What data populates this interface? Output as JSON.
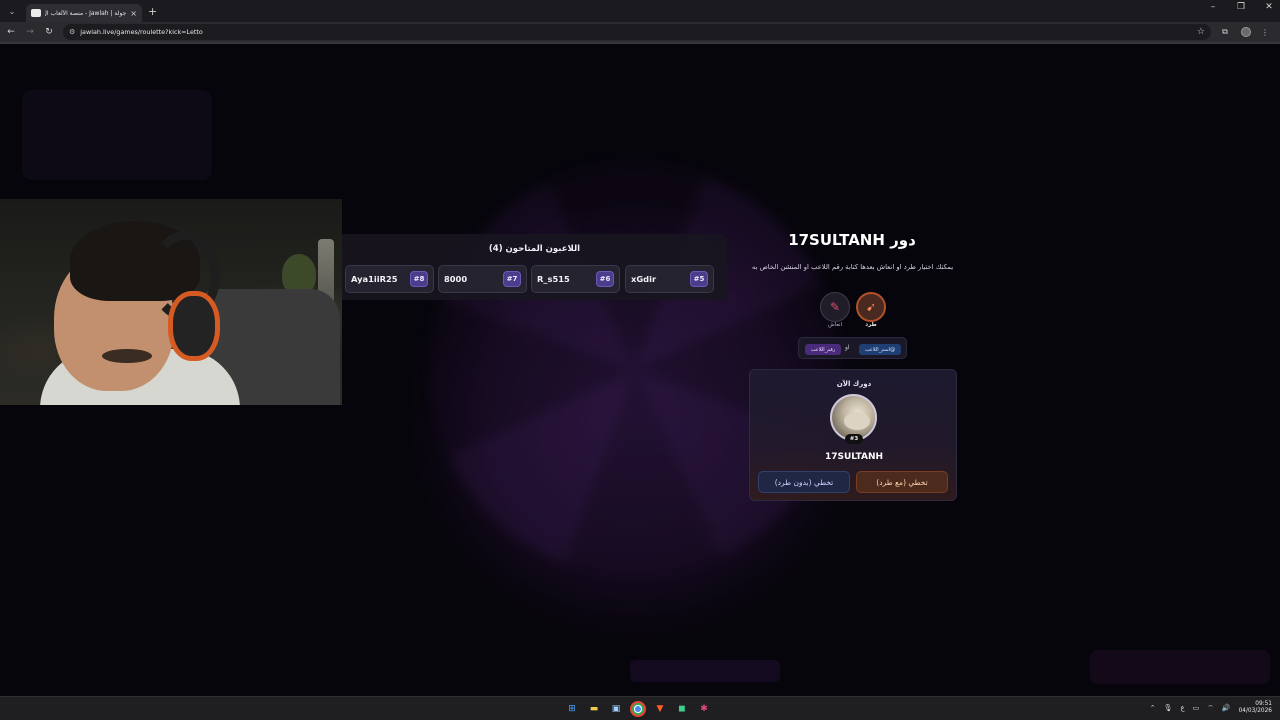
{
  "browser": {
    "tab_title": "جولة | Jawlah - منصة الألعاب ال...",
    "tab_close": "×",
    "new_tab": "+",
    "url": "jawlah.live/games/roulette?kick=Letto",
    "window_controls": {
      "minimize": "–",
      "maximize": "❐",
      "close": "✕"
    }
  },
  "qualified_players": {
    "title": "اللاعبون المتاحون (4)",
    "players": [
      {
        "name": "Aya1iiR25",
        "rank": "#8"
      },
      {
        "name": "8000",
        "rank": "#7"
      },
      {
        "name": "R_s515",
        "rank": "#6"
      },
      {
        "name": "xGdir",
        "rank": "#5"
      }
    ]
  },
  "turn": {
    "title": "دور 17SULTANH",
    "description": "يمكنك اختيار طرد او انعاش بعدها كتابة رقم اللاعب او المنشن الخاص به",
    "actions": [
      {
        "label": "طرد",
        "icon": "kick-icon",
        "selected": true
      },
      {
        "label": "انعاش",
        "icon": "syringe-icon",
        "selected": false
      }
    ],
    "input_hint": {
      "username_pill": "@اسم_اللاعب",
      "or": "او",
      "number_pill": "رقم_اللاعب"
    }
  },
  "current_turn": {
    "label": "دورك الآن",
    "rank": "#3",
    "player_name": "17SULTANH",
    "skip_with_kick": "تخطي (مع طرد)",
    "skip_without_kick": "تخطي (بدون طرد)"
  },
  "taskbar": {
    "clock_time": "09:51",
    "clock_date": "04/03/2026",
    "lang": "ع"
  },
  "colors": {
    "background": "#07050c",
    "panel": "#181520",
    "rank_badge": "#4c3c8c",
    "kick_accent": "#b2512a",
    "skip_kick_button": "#4d2b1c",
    "skip_nokick_button": "#1f2744"
  }
}
